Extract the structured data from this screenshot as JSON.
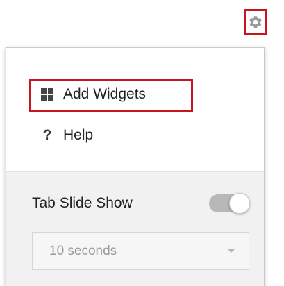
{
  "settings_button": {
    "icon": "gear-icon",
    "highlight_color": "#c8141e"
  },
  "menu": {
    "items": [
      {
        "label": "Add Widgets",
        "icon": "grid-icon",
        "highlighted": true
      },
      {
        "label": "Help",
        "icon": "question-mark-icon",
        "glyph": "?"
      }
    ]
  },
  "slideshow": {
    "label": "Tab Slide Show",
    "toggle_on": true,
    "interval": {
      "selected": "10 seconds"
    }
  },
  "colors": {
    "accent": "#c8141e",
    "panel_bottom_bg": "#f1f1f1",
    "text": "#222222",
    "muted_text": "#9a9a9a"
  }
}
